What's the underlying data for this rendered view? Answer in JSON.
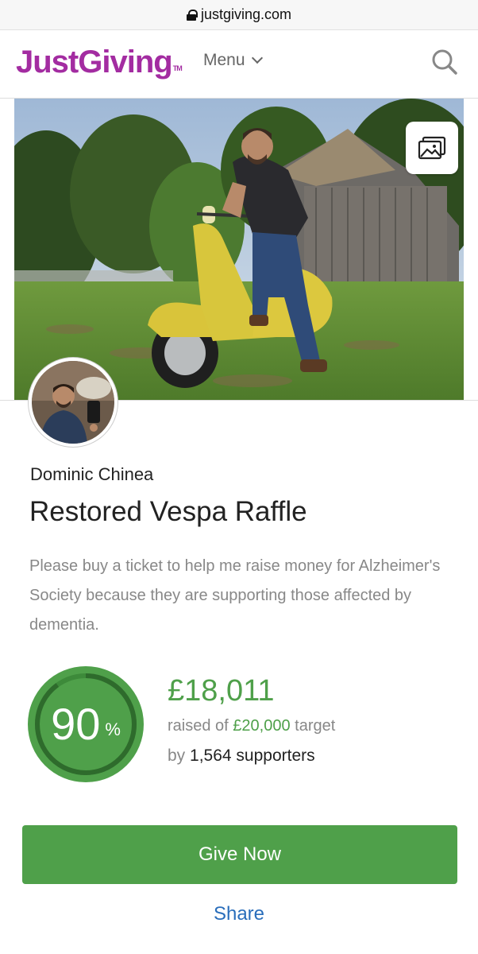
{
  "browser": {
    "url": "justgiving.com"
  },
  "header": {
    "logo": "JustGiving",
    "logo_tm": "TM",
    "menu_label": "Menu"
  },
  "page": {
    "owner_name": "Dominic Chinea",
    "title": "Restored Vespa Raffle",
    "description": "Please buy a ticket to help me raise money for Alzheimer's Society because they are supporting those affected by dementia."
  },
  "progress": {
    "percent": "90",
    "percent_symbol": "%",
    "percent_value": 0.9,
    "raised": "£18,011",
    "raised_prefix": "raised of",
    "target": "£20,000",
    "target_suffix": "target",
    "by_prefix": "by",
    "supporters": "1,564 supporters"
  },
  "actions": {
    "give_label": "Give Now",
    "share_label": "Share"
  },
  "colors": {
    "brand": "#a32ca1",
    "green": "#4fa04a",
    "link": "#2a6ebb"
  }
}
